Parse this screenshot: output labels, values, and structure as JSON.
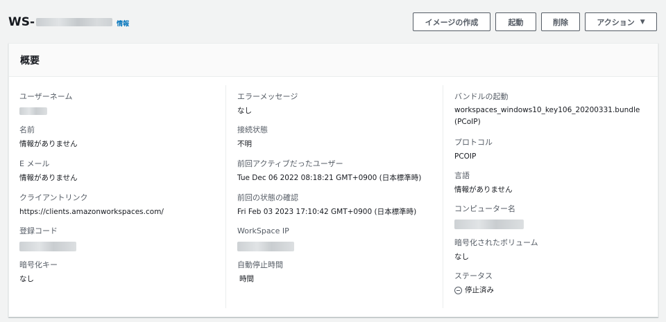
{
  "header": {
    "title_prefix": "WS-",
    "info_link": "情報",
    "buttons": {
      "create_image": "イメージの作成",
      "start": "起動",
      "delete": "削除",
      "actions": "アクション",
      "actions_caret": "▼"
    }
  },
  "panel": {
    "title": "概要",
    "col1": {
      "username_label": "ユーザーネーム",
      "name_label": "名前",
      "name_value": "情報がありません",
      "email_label": "E メール",
      "email_value": "情報がありません",
      "client_link_label": "クライアントリンク",
      "client_link_value": "https://clients.amazonworkspaces.com/",
      "reg_code_label": "登録コード",
      "enc_key_label": "暗号化キー",
      "enc_key_value": "なし"
    },
    "col2": {
      "error_label": "エラーメッセージ",
      "error_value": "なし",
      "conn_label": "接続状態",
      "conn_value": "不明",
      "last_user_label": "前回アクティブだったユーザー",
      "last_user_value": "Tue Dec 06 2022 08:18:21 GMT+0900 (日本標準時)",
      "last_check_label": "前回の状態の確認",
      "last_check_value": "Fri Feb 03 2023 17:10:42 GMT+0900 (日本標準時)",
      "ip_label": "WorkSpace IP",
      "autostop_label": "自動停止時間",
      "autostop_value": "時間"
    },
    "col3": {
      "bundle_label": "バンドルの起動",
      "bundle_value": "workspaces_windows10_key106_20200331.bundle (PCoIP)",
      "protocol_label": "プロトコル",
      "protocol_value": "PCOIP",
      "lang_label": "言語",
      "lang_value": "情報がありません",
      "computer_label": "コンピューター名",
      "enc_vol_label": "暗号化されたボリューム",
      "enc_vol_value": "なし",
      "status_label": "ステータス",
      "status_value": "停止済み"
    }
  }
}
